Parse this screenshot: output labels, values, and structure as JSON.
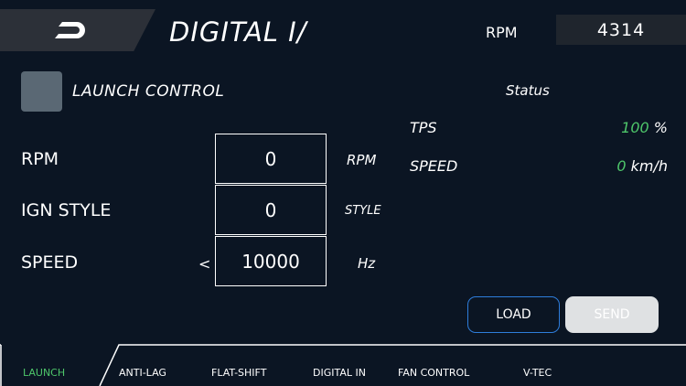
{
  "header": {
    "title": "DIGITAL I/",
    "rpm_label": "RPM",
    "rpm_value": "4314",
    "logo_icon": "d-logo-icon"
  },
  "launch_control": {
    "label": "LAUNCH CONTROL",
    "checked": false
  },
  "status": {
    "title": "Status",
    "rows": [
      {
        "label": "TPS",
        "value": "100",
        "unit": "%"
      },
      {
        "label": "SPEED",
        "value": "0",
        "unit": "km/h"
      }
    ]
  },
  "params": [
    {
      "label": "RPM",
      "value": "0",
      "unit": "RPM",
      "prefix": ""
    },
    {
      "label": "IGN STYLE",
      "value": "0",
      "unit": "STYLE",
      "prefix": ""
    },
    {
      "label": "SPEED",
      "value": "10000",
      "unit": "Hz",
      "prefix": "<"
    }
  ],
  "buttons": {
    "load": "LOAD",
    "send": "SEND"
  },
  "tabs": [
    {
      "label": "LAUNCH",
      "active": true
    },
    {
      "label": "ANTI-LAG",
      "active": false
    },
    {
      "label": "FLAT-SHIFT",
      "active": false
    },
    {
      "label": "DIGITAL IN",
      "active": false
    },
    {
      "label": "FAN CONTROL",
      "active": false
    },
    {
      "label": "V-TEC",
      "active": false
    }
  ],
  "colors": {
    "background": "#0b1523",
    "accent_green": "#4ec66a",
    "accent_blue": "#2e7ddb"
  }
}
